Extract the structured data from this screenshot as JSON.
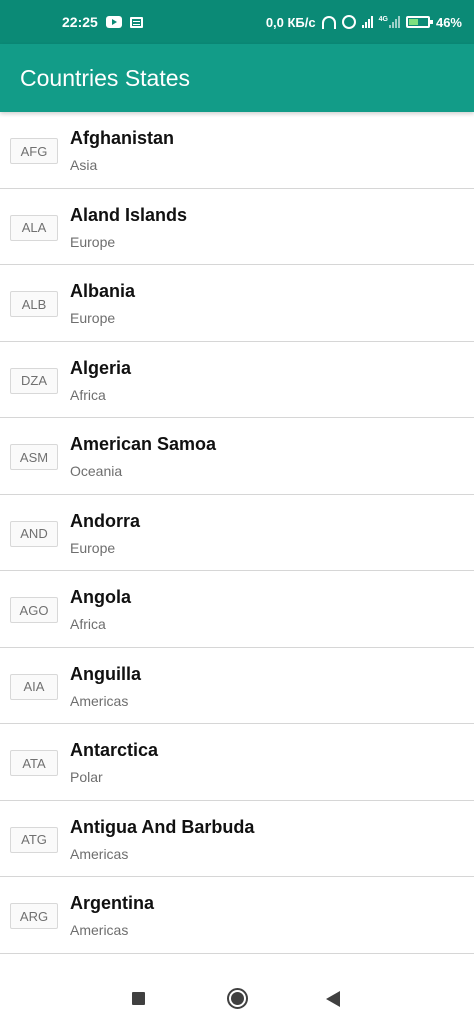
{
  "status_bar": {
    "time": "22:25",
    "network_speed": "0,0 КБ/с",
    "network_type": "4G",
    "battery": "46%"
  },
  "app_bar": {
    "title": "Countries States"
  },
  "colors": {
    "status_bar": "#0b8a76",
    "app_bar": "#129c88"
  },
  "countries": [
    {
      "code": "AFG",
      "name": "Afghanistan",
      "region": "Asia"
    },
    {
      "code": "ALA",
      "name": "Aland Islands",
      "region": "Europe"
    },
    {
      "code": "ALB",
      "name": "Albania",
      "region": "Europe"
    },
    {
      "code": "DZA",
      "name": "Algeria",
      "region": "Africa"
    },
    {
      "code": "ASM",
      "name": "American Samoa",
      "region": "Oceania"
    },
    {
      "code": "AND",
      "name": "Andorra",
      "region": "Europe"
    },
    {
      "code": "AGO",
      "name": "Angola",
      "region": "Africa"
    },
    {
      "code": "AIA",
      "name": "Anguilla",
      "region": "Americas"
    },
    {
      "code": "ATA",
      "name": "Antarctica",
      "region": "Polar"
    },
    {
      "code": "ATG",
      "name": "Antigua And Barbuda",
      "region": "Americas"
    },
    {
      "code": "ARG",
      "name": "Argentina",
      "region": "Americas"
    }
  ]
}
